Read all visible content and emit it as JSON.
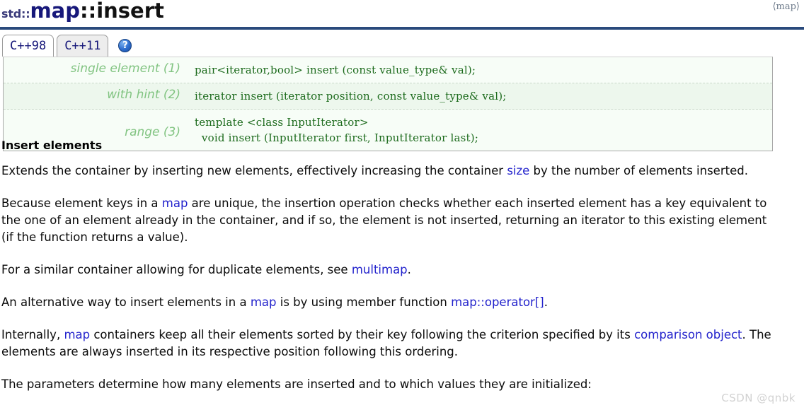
{
  "header": {
    "namespace": "std::",
    "class": "map",
    "separator": "::",
    "function": "insert",
    "include": "⟨map⟩"
  },
  "tabs": [
    {
      "label": "C++98",
      "active": true
    },
    {
      "label": "C++11",
      "active": false
    }
  ],
  "help": {
    "glyph": "?",
    "name": "help-icon"
  },
  "signatures": [
    {
      "label": "single element (1)",
      "code": "pair<iterator,bool> insert (const value_type& val);"
    },
    {
      "label": "with hint (2)",
      "code": "iterator insert (iterator position, const value_type& val);"
    },
    {
      "label": "range (3)",
      "code": "template <class InputIterator>\n  void insert (InputIterator first, InputIterator last);"
    }
  ],
  "body": {
    "heading": "Insert elements",
    "p1": {
      "t1": "Extends the container by inserting new elements, effectively increasing the container ",
      "link1": "size",
      "t2": " by the number of elements inserted."
    },
    "p2": {
      "t1": "Because element keys in a ",
      "link1": "map",
      "t2": " are unique, the insertion operation checks whether each inserted element has a key equivalent to the one of an element already in the container, and if so, the element is not inserted, returning an iterator to this existing element (if the function returns a value)."
    },
    "p3": {
      "t1": "For a similar container allowing for duplicate elements, see ",
      "link1": "multimap",
      "t2": "."
    },
    "p4": {
      "t1": "An alternative way to insert elements in a ",
      "link1": "map",
      "t2": " is by using member function ",
      "link2": "map::operator[]",
      "t3": "."
    },
    "p5": {
      "t1": "Internally, ",
      "link1": "map",
      "t2": " containers keep all their elements sorted by their key following the criterion specified by its ",
      "link2": "comparison object",
      "t3": ". The elements are always inserted in its respective position following this ordering."
    },
    "p6": {
      "t1": "The parameters determine how many elements are inserted and to which values they are initialized:"
    }
  },
  "watermark": "CSDN @qnbk",
  "colors": {
    "rule": "#2a4a7c",
    "link": "#2222cc",
    "sig_label": "#82c482",
    "sig_code": "#1d6b1d",
    "title_class": "#17187a"
  }
}
